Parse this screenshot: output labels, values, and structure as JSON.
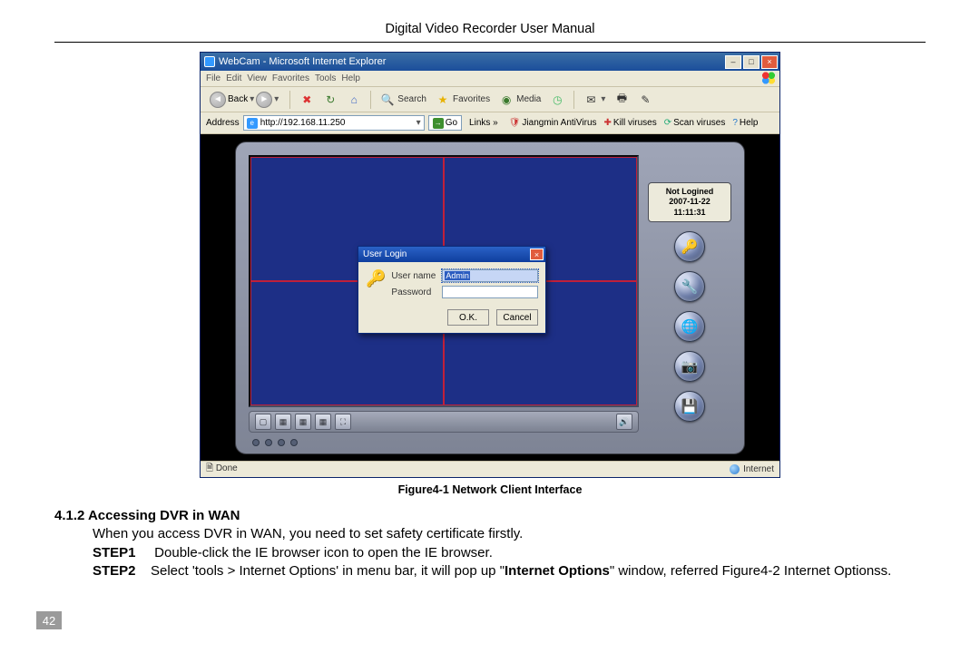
{
  "header": {
    "title": "Digital Video Recorder User Manual"
  },
  "ie": {
    "title": "WebCam - Microsoft Internet Explorer",
    "menu": {
      "file": "File",
      "edit": "Edit",
      "view": "View",
      "favorites": "Favorites",
      "tools": "Tools",
      "help": "Help"
    },
    "toolbar": {
      "back": "Back",
      "search": "Search",
      "favorites": "Favorites",
      "media": "Media"
    },
    "address": {
      "label": "Address",
      "value": "http://192.168.11.250",
      "go": "Go",
      "links": "Links  »",
      "av": "Jiangmin AntiVirus",
      "kill": "Kill viruses",
      "scan": "Scan viruses",
      "help": "Help"
    },
    "status": {
      "left": "Done",
      "right": "Internet"
    }
  },
  "client": {
    "status": {
      "line1": "Not Logined",
      "line2": "2007-11-22",
      "line3": "11:11:31"
    },
    "login": {
      "title": "User Login",
      "username_label": "User name",
      "username_value": "Admin",
      "password_label": "Password",
      "ok": "O.K.",
      "cancel": "Cancel"
    }
  },
  "figure_caption": "Figure4-1 Network Client Interface",
  "section": {
    "heading": "4.1.2  Accessing DVR in WAN",
    "intro": "When you access DVR in WAN, you need to set safety certificate firstly.",
    "step1_label": "STEP1",
    "step1_text": "Double-click the IE browser icon to open the IE browser.",
    "step2_label": "STEP2",
    "step2_text_a": "Select  'tools  >  Internet  Options'  in  menu  bar,  it  will  pop  up  \"",
    "step2_bold": "Internet  Options",
    "step2_text_b": "\"  window,  referred  Figure4-2 Internet Optionss.",
    "page_number": "42"
  }
}
